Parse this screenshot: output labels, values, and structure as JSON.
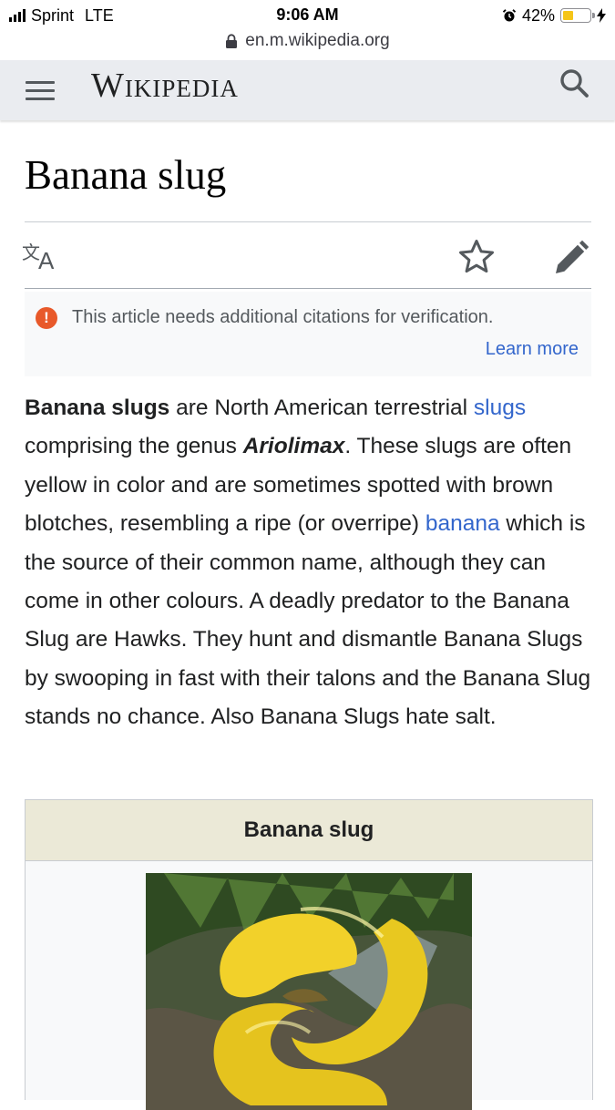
{
  "status_bar": {
    "carrier": "Sprint",
    "network": "LTE",
    "time": "9:06 AM",
    "battery_percent": "42%",
    "battery_level": 0.42,
    "url": "en.m.wikipedia.org"
  },
  "header": {
    "wordmark": "Wikipedia",
    "menu_icon": "hamburger-menu-icon",
    "search_icon": "search-icon"
  },
  "article": {
    "title": "Banana slug",
    "actions": {
      "language_icon": "language-icon",
      "watch_icon": "star-icon",
      "edit_icon": "pencil-icon"
    },
    "notice": {
      "text": "This article needs additional citations for verification.",
      "link": "Learn more"
    },
    "paragraph": {
      "lead_bold": "Banana slugs",
      "t1": " are North American terrestrial ",
      "link_slugs": "slugs",
      "t2": " comprising the genus ",
      "genus": "Ariolimax",
      "t3": ". These slugs are often yellow in color and are sometimes spotted with brown blotches, resembling a ripe (or overripe) ",
      "link_banana": "banana",
      "t4": " which is the source of their common name, although they can come in other colours. A deadly predator to the Banana Slug are Hawks. They hunt and dismantle Banana Slugs by swooping in fast with their talons and the Banana Slug stands no chance. Also Banana Slugs hate salt."
    },
    "infobox": {
      "title": "Banana slug"
    }
  },
  "colors": {
    "link": "#3366cc",
    "header_bg": "#eaecf0",
    "warning": "#e8592a",
    "infobox_title_bg": "#ebe9d7",
    "slug_yellow": "#f2d12a"
  }
}
